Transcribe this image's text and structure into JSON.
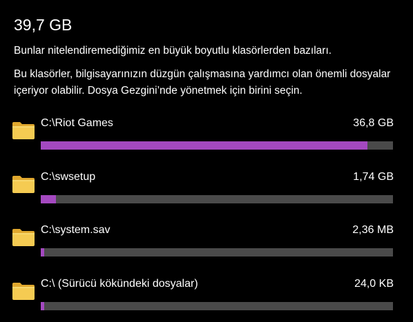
{
  "header": {
    "total_size": "39,7 GB",
    "description_1": "Bunlar nitelendiremediğimiz en büyük boyutlu klasörlerden bazıları.",
    "description_2": "Bu klasörler, bilgisayarınızın düzgün çalışmasına yardımcı olan önemli dosyalar içeriyor olabilir. Dosya Gezgini’nde yönetmek için birini seçin."
  },
  "colors": {
    "background": "#000000",
    "bar_fill": "#a449c0",
    "bar_track": "#4a4a4a",
    "folder_yellow": "#f2c94c"
  },
  "folders": [
    {
      "name": "C:\\Riot Games",
      "size": "36,8 GB",
      "usage_fraction": 0.927,
      "icon": "folder-icon"
    },
    {
      "name": "C:\\swsetup",
      "size": "1,74 GB",
      "usage_fraction": 0.044,
      "icon": "folder-icon"
    },
    {
      "name": "C:\\system.sav",
      "size": "2,36 MB",
      "usage_fraction": 0.01,
      "icon": "folder-icon"
    },
    {
      "name": "C:\\ (Sürücü kökündeki dosyalar)",
      "size": "24,0 KB",
      "usage_fraction": 0.01,
      "icon": "folder-icon"
    }
  ]
}
